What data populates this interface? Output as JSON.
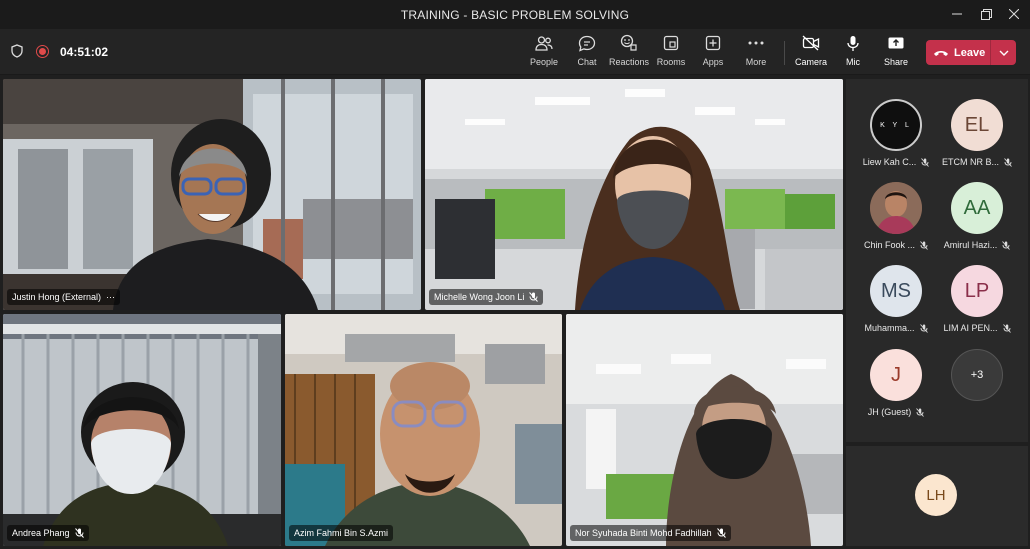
{
  "window": {
    "title": "TRAINING - BASIC PROBLEM SOLVING"
  },
  "toolbar": {
    "timer": "04:51:02",
    "buttons": {
      "people": "People",
      "chat": "Chat",
      "reactions": "Reactions",
      "rooms": "Rooms",
      "apps": "Apps",
      "more": "More",
      "camera": "Camera",
      "mic": "Mic",
      "share": "Share"
    },
    "leave": "Leave"
  },
  "colors": {
    "leave": "#c4314b",
    "recording": "#e04a4a",
    "background": "#1f1f1f"
  },
  "videos": [
    {
      "name": "Justin Hong (External)",
      "more": "···"
    },
    {
      "name": "Michelle Wong Joon Li"
    },
    {
      "name": "Andrea Phang"
    },
    {
      "name": "Azim Fahmi Bin S.Azmi"
    },
    {
      "name": "Nor Syuhada Binti Mohd Fadhillah"
    }
  ],
  "roster": {
    "participants": [
      {
        "name": "Liew Kah C...",
        "logo": "K Y L"
      },
      {
        "name": "ETCM NR B...",
        "initials": "EL"
      },
      {
        "name": "Chin Fook ..."
      },
      {
        "name": "Amirul Hazi...",
        "initials": "AA"
      },
      {
        "name": "Muhamma...",
        "initials": "MS"
      },
      {
        "name": "LIM AI PEN...",
        "initials": "LP"
      },
      {
        "name": "JH (Guest)",
        "initials": "J"
      }
    ],
    "more_count": "+3"
  },
  "self_view": {
    "initials": "LH"
  }
}
